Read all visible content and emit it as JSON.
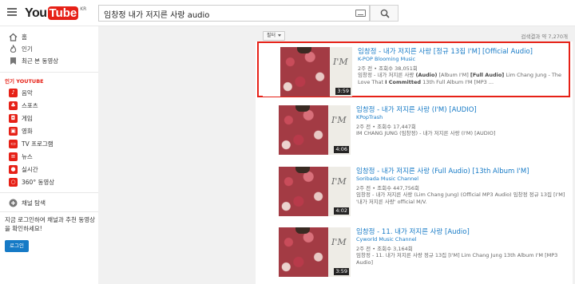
{
  "header": {
    "logo_you": "You",
    "logo_tube": "Tube",
    "logo_region": "KR",
    "search_query": "임창정 내가 저지른 사랑 audio"
  },
  "sidebar": {
    "items": [
      {
        "label": "홈",
        "icon": "home-icon"
      },
      {
        "label": "인기",
        "icon": "fire-icon"
      },
      {
        "label": "최근 본 동영상",
        "icon": "history-icon"
      }
    ],
    "section_title": "인기 YOUTUBE",
    "categories": [
      {
        "label": "음악",
        "icon": "music-icon"
      },
      {
        "label": "스포츠",
        "icon": "sports-icon"
      },
      {
        "label": "게임",
        "icon": "gaming-icon"
      },
      {
        "label": "영화",
        "icon": "movies-icon"
      },
      {
        "label": "TV 프로그램",
        "icon": "tv-icon"
      },
      {
        "label": "뉴스",
        "icon": "news-icon"
      },
      {
        "label": "실시간",
        "icon": "live-icon"
      },
      {
        "label": "360° 동영상",
        "icon": "360-icon"
      }
    ],
    "browse_channels": "채널 탐색",
    "login_prompt": "지금 로그인하여 채널과 추천 동영상을 확인하세요!",
    "login_button": "로그인"
  },
  "results": {
    "filter_label": "필터",
    "count_text": "검색결과 약 7,270개",
    "items": [
      {
        "title": "임창정 - 내가 저지른 사랑 [정규 13집 I'M] [Official Audio]",
        "channel": "K-POP Blooming Music",
        "meta": "2주 전 • 조회수 38,051회",
        "desc_parts": [
          "임창정 - 내가 저지른 사랑 ",
          "(Audio)",
          " [Album I'M] ",
          "[Full Audio]",
          " Lim Chang Jung - The Love That ",
          "I Committed",
          " 13th Full Album I'M [MP3 ..."
        ],
        "duration": "3:59",
        "selected": true
      },
      {
        "title": "임창정 - 내가 저지른 사랑 (I'M) [AUDIO]",
        "channel": "KPopTrash",
        "meta": "2주 전 • 조회수 17,447회",
        "desc_parts": [
          "IM CHANG JUNG (임창정) - 내가 저지른 사랑 (I'M) [AUDIO]"
        ],
        "duration": "4:06",
        "selected": false
      },
      {
        "title": "임창정 - 내가 저지른 사랑 (Full Audio) [13th Album I'M]",
        "channel": "Soribada Music Channel",
        "meta": "2주 전 • 조회수 447,756회",
        "desc_parts": [
          "임창정 - 내가 저지른 사랑 (Lim Chang Jung) (Official MP3 Audio) 임창정 정규 13집 [I'M] '내가 저지른 사랑' official M/V."
        ],
        "duration": "4:02",
        "selected": false
      },
      {
        "title": "임창정 - 11. 내가 저지른 사랑 [Audio]",
        "channel": "Cyworld Music Channel",
        "meta": "2주 전 • 조회수 3,164회",
        "desc_parts": [
          "임창정 - 11. 내가 저지른 사랑 정규 13집 [I'M] Lim Chang Jung 13th Album I'M [MP3 Audio]"
        ],
        "duration": "3:59",
        "selected": false
      }
    ]
  },
  "colors": {
    "brand_red": "#e62117",
    "link_blue": "#167ac6"
  }
}
